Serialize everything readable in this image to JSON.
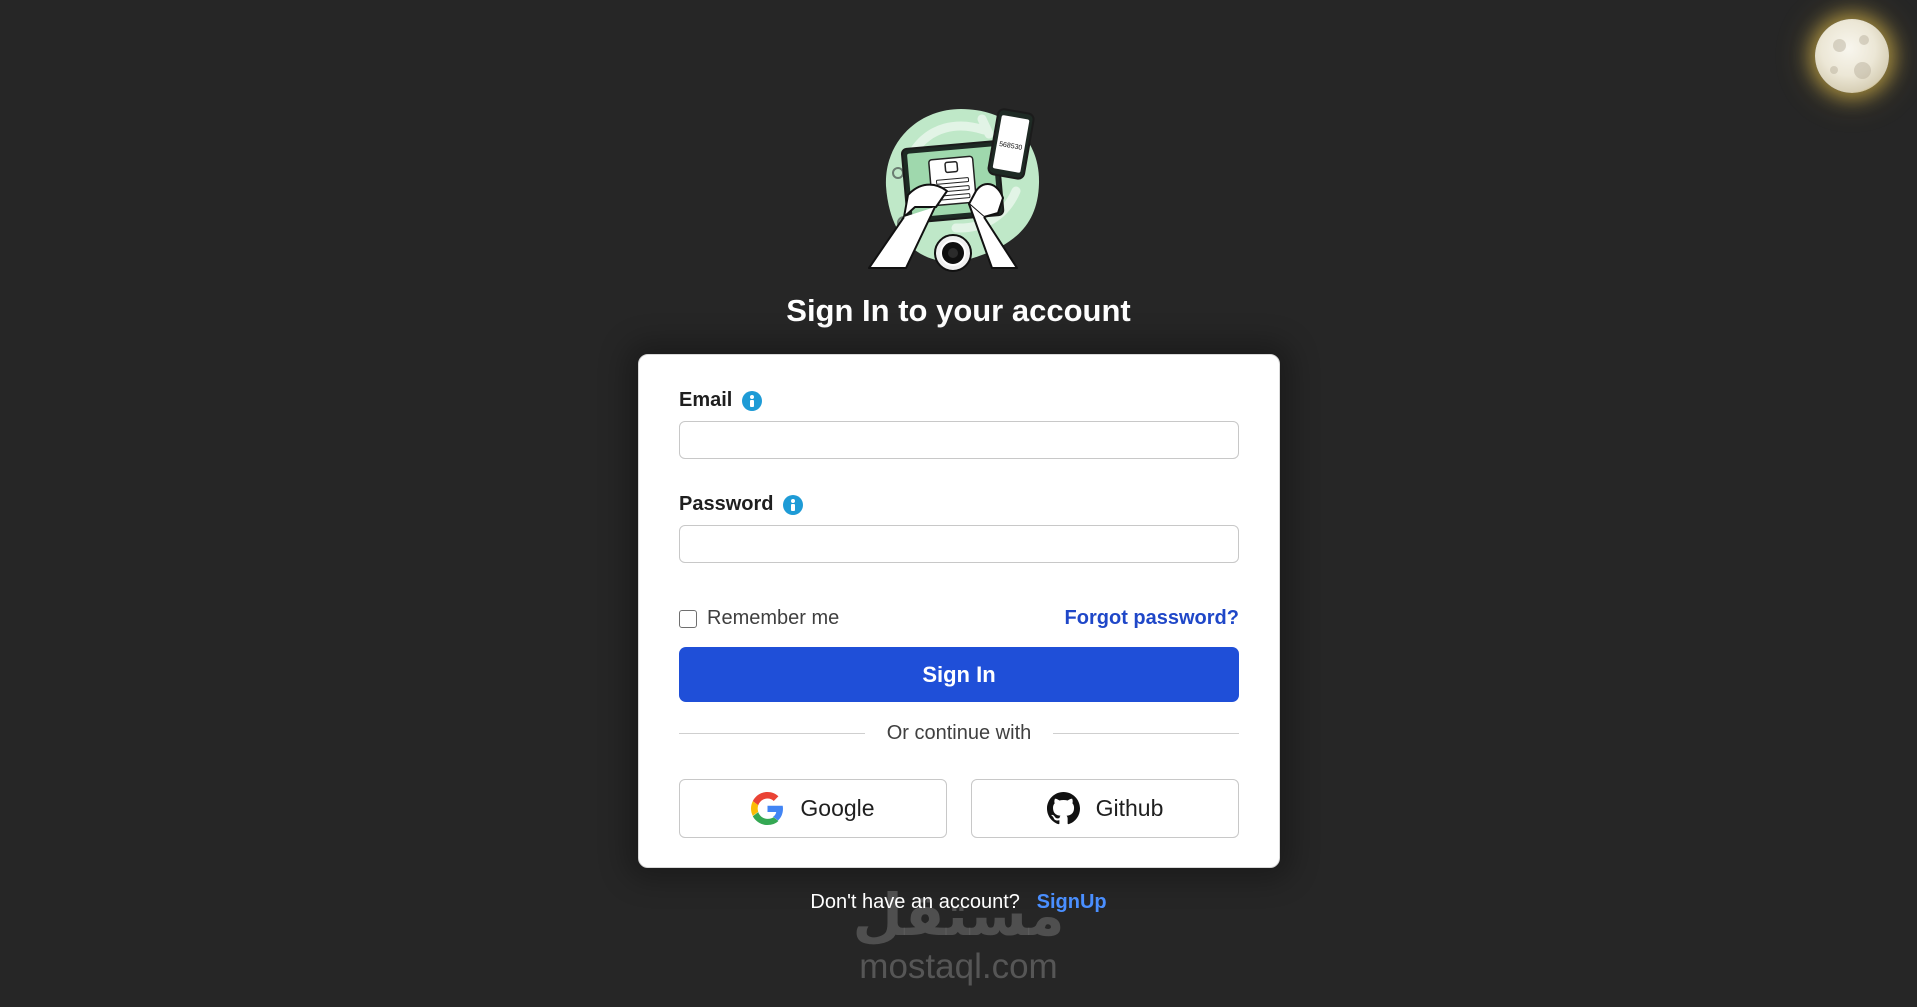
{
  "header": {
    "title": "Sign In to your account"
  },
  "theme_toggle": {
    "icon": "moon-icon"
  },
  "illustration": {
    "phone_code": "568530"
  },
  "form": {
    "email_label": "Email",
    "password_label": "Password",
    "email_value": "",
    "password_value": "",
    "remember_label": "Remember me",
    "forgot_label": "Forgot password?",
    "signin_label": "Sign In",
    "divider_label": "Or continue with",
    "google_label": "Google",
    "github_label": "Github"
  },
  "footer": {
    "prompt": "Don't have an account?",
    "signup_label": "SignUp"
  },
  "watermark": {
    "arabic": "مستقل",
    "latin": "mostaql.com"
  },
  "colors": {
    "background": "#262626",
    "primary": "#1f4fd8",
    "link": "#1f47c8",
    "signup_link": "#4a8fff",
    "info": "#1e9bd6"
  }
}
